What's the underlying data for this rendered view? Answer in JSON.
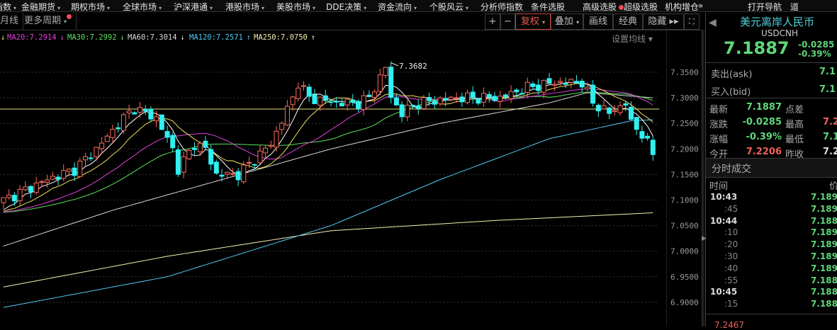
{
  "menu": [
    {
      "label": "指数",
      "caret": true
    },
    {
      "label": "金融期货",
      "caret": true
    },
    {
      "label": "期权市场",
      "caret": true
    },
    {
      "label": "全球市场",
      "caret": true
    },
    {
      "label": "沪深港通",
      "caret": true
    },
    {
      "label": "港股市场",
      "caret": true
    },
    {
      "label": "美股市场",
      "caret": true
    },
    {
      "label": "DDE决策",
      "caret": true
    },
    {
      "label": "资金流向",
      "caret": true
    },
    {
      "label": "个股风云",
      "caret": true
    },
    {
      "label": "分析师指数"
    },
    {
      "label": "条件选股"
    },
    {
      "label": "高级选股",
      "dot": true
    },
    {
      "label": "超级选股"
    },
    {
      "label": "机构增仓"
    },
    {
      "label": "»"
    },
    {
      "label": "打开导航"
    },
    {
      "label": "道"
    }
  ],
  "periods": {
    "month": "月线",
    "more": "更多周期"
  },
  "toolbar": {
    "zoom_in": "+",
    "zoom_out": "−",
    "fuquan": "复权",
    "overlay": "叠加",
    "draw": "画线",
    "classic": "经典",
    "hide": "隐藏 ▸▸",
    "fullscreen": "⛶"
  },
  "ma_legend": [
    {
      "label": "MA20:7.2914",
      "arrow": "↓",
      "color": "#e040e0"
    },
    {
      "label": "MA30:7.2992",
      "arrow": "↓",
      "color": "#5ee05e"
    },
    {
      "label": "MA60:7.3014",
      "arrow": "↓",
      "color": "#d8d8d8"
    },
    {
      "label": "MA120:7.2571",
      "arrow": "↑",
      "color": "#4fc8f0"
    },
    {
      "label": "MA250:7.0750",
      "arrow": "↑",
      "color": "#f5f0b0"
    }
  ],
  "ma_first_arrow": "↓",
  "set_ma": "设置均线 ▾",
  "chart_data": {
    "type": "candlestick",
    "y_ticks": [
      "7.3500",
      "7.3000",
      "7.2500",
      "7.2000",
      "7.1500",
      "7.1000",
      "7.0500",
      "7.0000",
      "6.9500",
      "6.9000"
    ],
    "ylim": [
      6.9,
      7.35
    ],
    "peak_label": "7.3682",
    "peak_value": 7.3682,
    "reference_line": 7.278,
    "close_path": [
      [
        0,
        7.1
      ],
      [
        8,
        7.14
      ],
      [
        13,
        7.16
      ],
      [
        17,
        7.2
      ],
      [
        22,
        7.26
      ],
      [
        24,
        7.28
      ],
      [
        28,
        7.26
      ],
      [
        31,
        7.2
      ],
      [
        32,
        7.16
      ],
      [
        35,
        7.21
      ],
      [
        37,
        7.2
      ],
      [
        39,
        7.15
      ],
      [
        43,
        7.15
      ],
      [
        46,
        7.18
      ],
      [
        49,
        7.21
      ],
      [
        53,
        7.3
      ],
      [
        54,
        7.33
      ],
      [
        56,
        7.3
      ],
      [
        61,
        7.29
      ],
      [
        65,
        7.29
      ],
      [
        67,
        7.3
      ],
      [
        70,
        7.36
      ],
      [
        71,
        7.3
      ],
      [
        73,
        7.27
      ],
      [
        76,
        7.29
      ],
      [
        83,
        7.3
      ],
      [
        91,
        7.3
      ],
      [
        96,
        7.32
      ],
      [
        101,
        7.33
      ],
      [
        106,
        7.33
      ],
      [
        108,
        7.29
      ],
      [
        111,
        7.27
      ],
      [
        114,
        7.29
      ],
      [
        115,
        7.25
      ],
      [
        117,
        7.23
      ],
      [
        119,
        7.19
      ]
    ],
    "ma60": [
      [
        0,
        7.01
      ],
      [
        20,
        7.08
      ],
      [
        40,
        7.14
      ],
      [
        60,
        7.2
      ],
      [
        80,
        7.25
      ],
      [
        100,
        7.29
      ],
      [
        107,
        7.31
      ],
      [
        119,
        7.3
      ]
    ],
    "ma120": [
      [
        0,
        6.89
      ],
      [
        30,
        6.95
      ],
      [
        60,
        7.05
      ],
      [
        80,
        7.14
      ],
      [
        100,
        7.22
      ],
      [
        115,
        7.255
      ],
      [
        119,
        7.257
      ]
    ],
    "ma250": [
      [
        0,
        6.93
      ],
      [
        30,
        6.99
      ],
      [
        60,
        7.04
      ],
      [
        90,
        7.06
      ],
      [
        119,
        7.075
      ]
    ]
  },
  "quote": {
    "name": "美元离岸人民币",
    "code": "USDCNH",
    "price": "7.1887",
    "change": "-0.0285",
    "pct": "-0.39%",
    "ask_label": "卖出(ask)",
    "ask": "7.1",
    "bid_label": "买入(bid)",
    "bid": "7.1",
    "stats": [
      {
        "l1": "最新",
        "v1": "7.1887",
        "c1": "g",
        "l2": "点差",
        "v2": "",
        "c2": "w"
      },
      {
        "l1": "涨跌",
        "v1": "-0.0285",
        "c1": "g",
        "l2": "最高",
        "v2": "7.2",
        "c2": "r"
      },
      {
        "l1": "涨幅",
        "v1": "-0.39%",
        "c1": "g",
        "l2": "最低",
        "v2": "7.1",
        "c2": "g"
      },
      {
        "l1": "今开",
        "v1": "7.2206",
        "c1": "r",
        "l2": "昨收",
        "v2": "7.2",
        "c2": "w"
      }
    ]
  },
  "ticks": {
    "title": "分时成交",
    "col_time": "时间",
    "col_price": "价",
    "rows": [
      {
        "t": "10:43",
        "p": "7.189",
        "major": true
      },
      {
        "t": ":45",
        "p": "7.189"
      },
      {
        "t": "10:44",
        "p": "7.188",
        "major": true
      },
      {
        "t": ":10",
        "p": "7.189"
      },
      {
        "t": ":20",
        "p": "7.189"
      },
      {
        "t": ":30",
        "p": "7.189"
      },
      {
        "t": ":40",
        "p": "7.189"
      },
      {
        "t": ":55",
        "p": "7.188"
      },
      {
        "t": "10:45",
        "p": "7.188",
        "major": true
      },
      {
        "t": ":15",
        "p": "7.188"
      }
    ],
    "footer": "7.2467"
  }
}
